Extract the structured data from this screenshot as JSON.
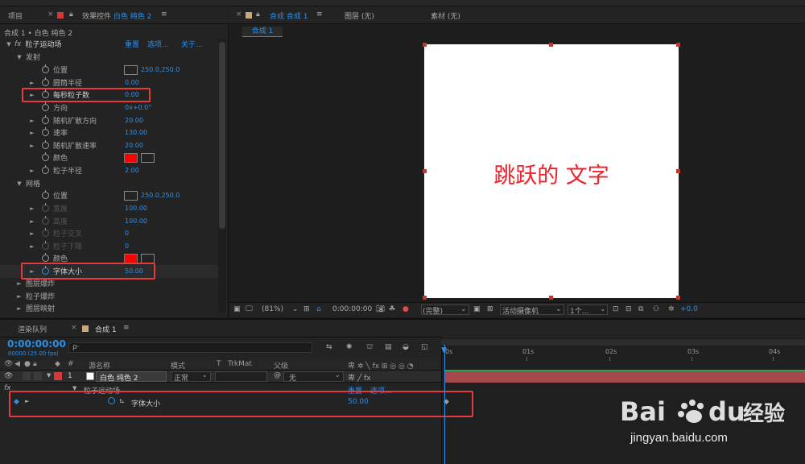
{
  "effect_controls": {
    "tab_project": "项目",
    "tab_effect": "效果控件",
    "tab_layer": "白色 纯色 2",
    "breadcrumb": "合成 1 • 白色 纯色 2",
    "fx": "fx",
    "effect_name": "粒子运动场",
    "reset": "重置",
    "options": "选项...",
    "about": "关于...",
    "emit_group": "发射",
    "grid_group": "网格",
    "props": {
      "position": "位置",
      "position_val": "250.0,250.0",
      "barrel_radius": "圆筒半径",
      "barrel_radius_val": "0.00",
      "particles_per_sec": "每秒粒子数",
      "particles_per_sec_val": "0.00",
      "direction": "方向",
      "direction_val": "0x+0.0°",
      "random_spread_dir": "随机扩散方向",
      "random_spread_dir_val": "20.00",
      "velocity": "速率",
      "velocity_val": "130.00",
      "random_spread_vel": "随机扩散速率",
      "random_spread_vel_val": "20.00",
      "color": "颜色",
      "particle_radius": "粒子半径",
      "particle_radius_val": "2.00",
      "grid_position": "位置",
      "grid_position_val": "250.0,250.0",
      "width": "宽度",
      "width_val": "100.00",
      "height": "高度",
      "height_val": "100.00",
      "particles_across": "粒子交叉",
      "particles_across_val": "0",
      "particles_down": "粒子下降",
      "particles_down_val": "0",
      "grid_color": "颜色",
      "font_size": "字体大小",
      "font_size_val": "50.00"
    },
    "layer_explode": "图层爆炸",
    "particle_explode": "粒子爆炸",
    "layer_map": "图层映射",
    "color_value": "#ff0000"
  },
  "viewer": {
    "comp_tab": "合成 合成 1",
    "layer_tab": "图层 (无)",
    "footage_tab": "素材 (无)",
    "sub_tab": "合成 1",
    "canvas_text": "跳跃的 文字",
    "zoom": "(81%)",
    "timecode": "0:00:00:00",
    "resolution": "(完整)",
    "camera": "活动摄像机",
    "views": "1个...",
    "exposure": "+0.0"
  },
  "timeline": {
    "tab_render": "渲染队列",
    "tab_comp": "合成 1",
    "timecode": "0:00:00:00",
    "frame_info": "00000 (25.00 fps)",
    "search_icon_label": "ρ·",
    "col_num": "#",
    "col_source": "源名称",
    "col_mode": "模式",
    "col_t": "T",
    "col_trkmat": "TrkMat",
    "col_parent": "父级",
    "layer_num": "1",
    "layer_name": "白色 纯色 2",
    "layer_mode": "正常",
    "layer_parent": "无",
    "effect_row": "粒子运动场",
    "effect_reset": "重置",
    "effect_options": "选项...",
    "prop_name": "字体大小",
    "prop_val": "50.00",
    "ruler": [
      "0s",
      "01s",
      "02s",
      "03s",
      "04s"
    ]
  },
  "watermark": {
    "brand": "Bai du 经验",
    "url": "jingyan.baidu.com"
  }
}
